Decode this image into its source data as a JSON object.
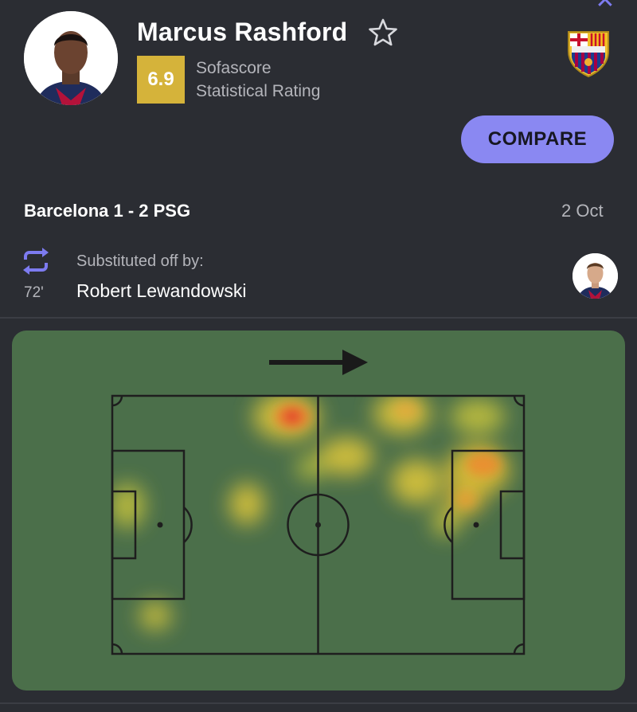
{
  "player": {
    "name": "Marcus Rashford",
    "rating": "6.9",
    "rating_label_line1": "Sofascore",
    "rating_label_line2": "Statistical Rating"
  },
  "club": {
    "crest_text": "FCB"
  },
  "actions": {
    "compare_label": "COMPARE"
  },
  "match": {
    "title": "Barcelona 1 - 2 PSG",
    "date": "2 Oct"
  },
  "substitution": {
    "minute": "72'",
    "label": "Substituted off by:",
    "player": "Robert Lewandowski"
  },
  "colors": {
    "background": "#2b2d33",
    "accent": "#8a88f2",
    "rating": "#d5b33a",
    "pitch": "#4b6f4a"
  },
  "icons": [
    "close-icon",
    "star-icon",
    "substitution-icon",
    "direction-arrow-icon"
  ]
}
